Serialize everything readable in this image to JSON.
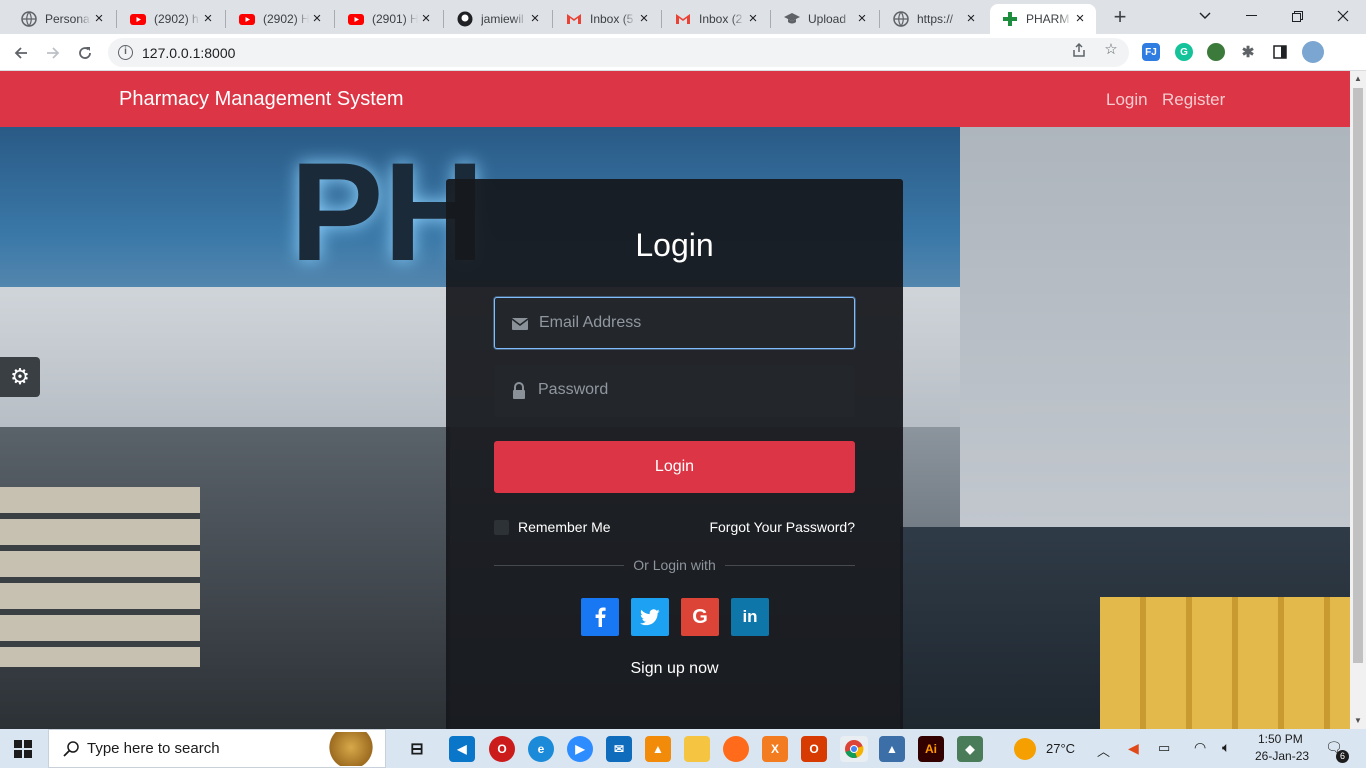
{
  "browser": {
    "tabs": [
      {
        "title": "Personal",
        "favicon": "globe-icon",
        "color": "#5f6368",
        "active": false
      },
      {
        "title": "(2902) h",
        "favicon": "youtube-icon",
        "color": "#ff0000",
        "active": false
      },
      {
        "title": "(2902) H",
        "favicon": "youtube-icon",
        "color": "#ff0000",
        "active": false
      },
      {
        "title": "(2901) H",
        "favicon": "youtube-icon",
        "color": "#ff0000",
        "active": false
      },
      {
        "title": "jamiewil",
        "favicon": "github-icon",
        "color": "#202124",
        "active": false
      },
      {
        "title": "Inbox (5",
        "favicon": "gmail-icon",
        "color": "#ea4335",
        "active": false
      },
      {
        "title": "Inbox (2",
        "favicon": "gmail-icon",
        "color": "#ea4335",
        "active": false
      },
      {
        "title": "Upload",
        "favicon": "graduation-cap-icon",
        "color": "#5f6368",
        "active": false
      },
      {
        "title": "https://",
        "favicon": "globe-icon",
        "color": "#5f6368",
        "active": false
      },
      {
        "title": "PHARM",
        "favicon": "pharmacy-icon",
        "color": "#1e8e3e",
        "active": true
      }
    ],
    "new_tab_label": "+",
    "url": "127.0.0.1:8000"
  },
  "navbar": {
    "brand": "Pharmacy Management System",
    "links": {
      "login": "Login",
      "register": "Register"
    },
    "color": "#dc3545"
  },
  "login_form": {
    "title": "Login",
    "email_placeholder": "Email Address",
    "password_placeholder": "Password",
    "submit_label": "Login",
    "remember_label": "Remember Me",
    "forgot_label": "Forgot Your Password?",
    "divider_label": "Or Login with",
    "socials": [
      {
        "name": "facebook",
        "glyph": "f",
        "color": "#1877f2"
      },
      {
        "name": "twitter",
        "glyph": "t",
        "color": "#1da1f2"
      },
      {
        "name": "google",
        "glyph": "G",
        "color": "#db4437"
      },
      {
        "name": "linkedin",
        "glyph": "in",
        "color": "#0e76a8"
      }
    ],
    "signup_label": "Sign up now"
  },
  "taskbar": {
    "search_placeholder": "Type here to search",
    "weather": "27°C",
    "time": "1:50 PM",
    "date": "26-Jan-23",
    "notification_count": "6"
  }
}
